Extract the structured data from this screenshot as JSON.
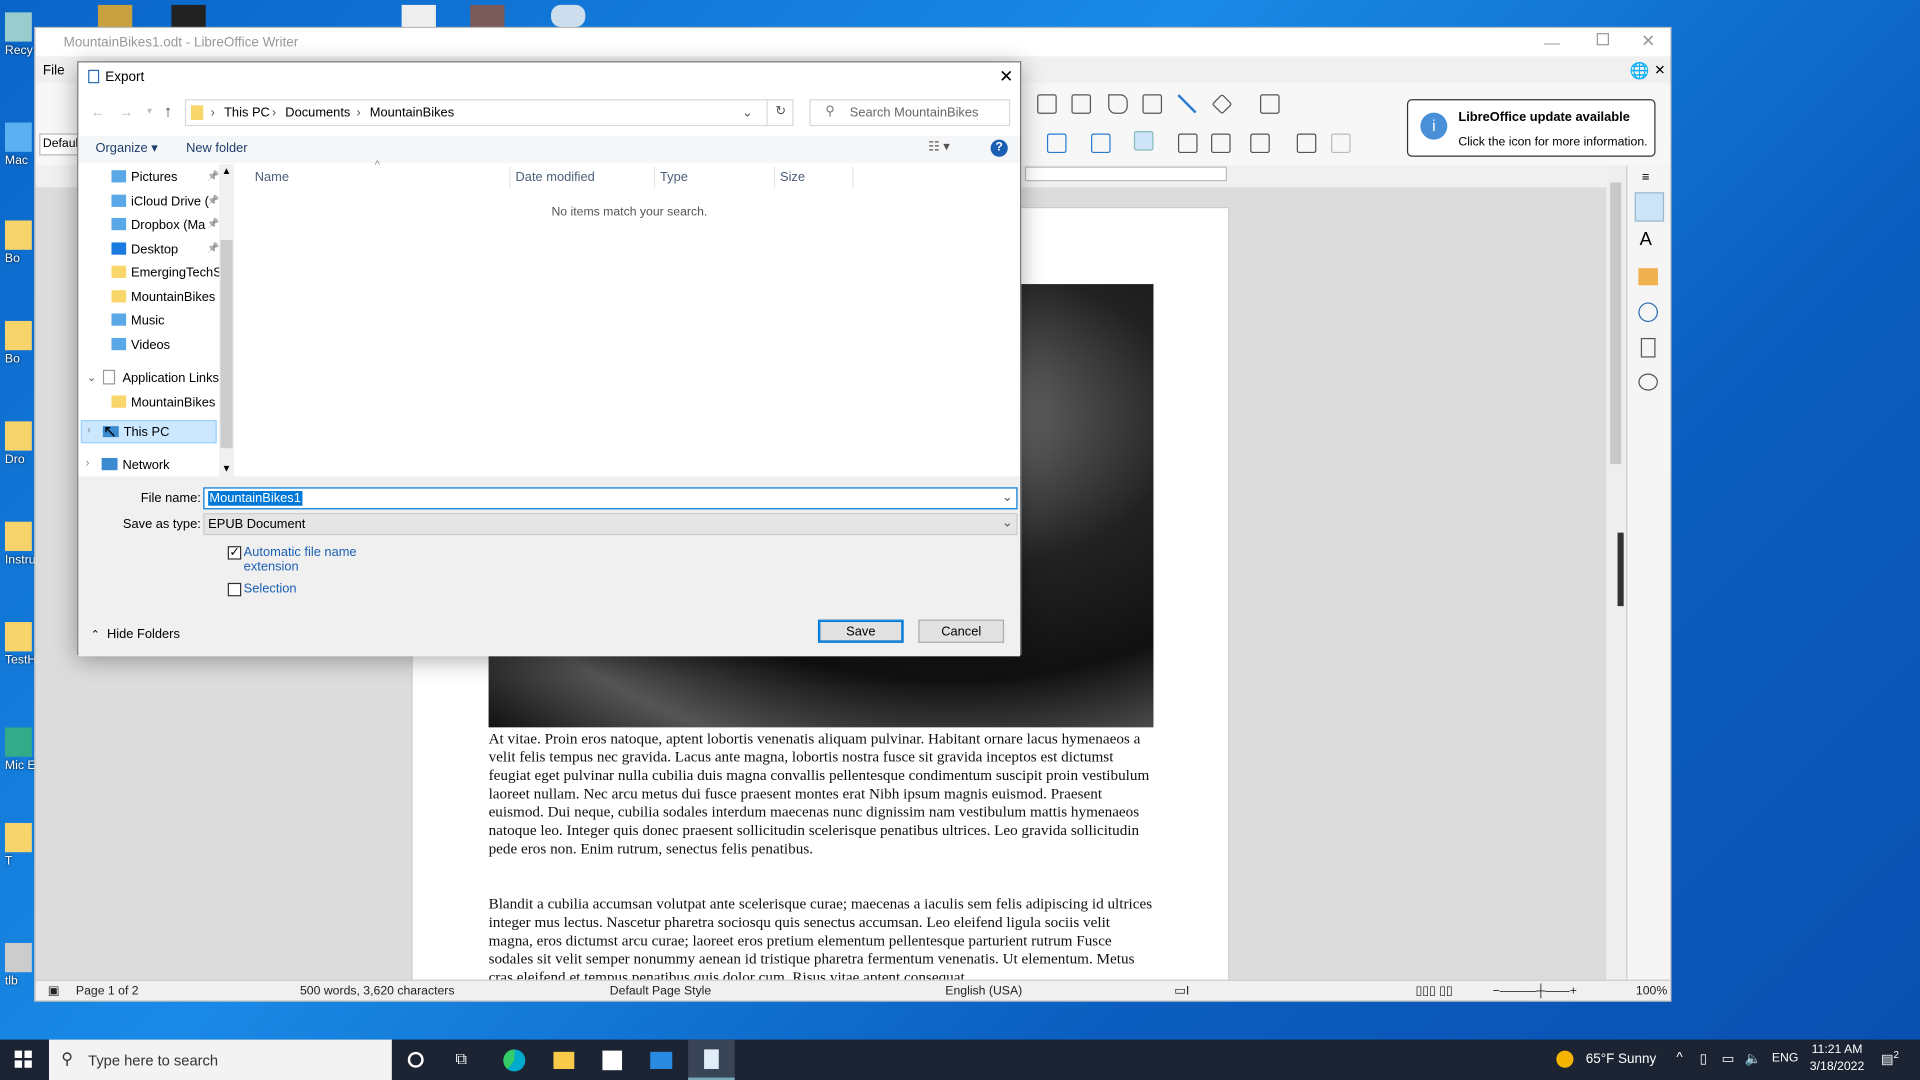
{
  "desktop": {
    "icons": [
      "Recy",
      "Mac",
      "Bo",
      "Bo",
      "Dro",
      "Instru",
      "TestH",
      "Mic Ed",
      "T",
      "tlb"
    ]
  },
  "writer": {
    "title": "MountainBikes1.odt - LibreOffice Writer",
    "menu_file": "File",
    "style_box": "Default",
    "paragraph1": "At vitae. Proin eros natoque, aptent lobortis venenatis aliquam pulvinar. Habitant ornare lacus hymenaeos a velit felis tempus nec gravida. Lacus ante magna, lobortis nostra fusce sit gravida inceptos est dictumst feugiat eget pulvinar nulla cubilia duis magna convallis pellentesque condimentum suscipit proin vestibulum laoreet nullam. Nec arcu metus dui fusce praesent montes erat Nibh ipsum magnis euismod. Praesent euismod. Dui neque, cubilia sodales interdum maecenas nunc dignissim nam vestibulum mattis hymenaeos natoque leo. Integer quis donec praesent sollicitudin scelerisque penatibus ultrices. Leo gravida sollicitudin pede eros non. Enim rutrum, senectus felis penatibus.",
    "paragraph2": "Blandit a cubilia accumsan volutpat ante scelerisque curae; maecenas a iaculis sem felis adipiscing id ultrices integer mus lectus. Nascetur pharetra sociosqu quis senectus accumsan. Leo eleifend ligula sociis velit magna, eros dictumst arcu curae; laoreet eros pretium elementum pellentesque parturient rutrum Fusce sodales sit velit semper nonummy aenean id tristique pharetra fermentum venenatis. Ut elementum. Metus cras eleifend et tempus penatibus quis dolor cum. Risus vitae aptent consequat",
    "status": {
      "page": "Page 1 of 2",
      "words": "500 words, 3,620 characters",
      "page_style": "Default Page Style",
      "language": "English (USA)",
      "zoom": "100%"
    },
    "zoom_percent": 100,
    "toast": {
      "title": "LibreOffice update available",
      "body": "Click the icon for more information."
    }
  },
  "dialog": {
    "title": "Export",
    "breadcrumb": [
      "This PC",
      "Documents",
      "MountainBikes"
    ],
    "search_placeholder": "Search MountainBikes",
    "organize": "Organize",
    "new_folder": "New folder",
    "nav": [
      {
        "label": "Pictures",
        "icon": "pictures-folder-icon",
        "pinned": true
      },
      {
        "label": "iCloud Drive (",
        "icon": "icloud-folder-icon",
        "pinned": true
      },
      {
        "label": "Dropbox (Ma",
        "icon": "dropbox-folder-icon",
        "pinned": true
      },
      {
        "label": "Desktop",
        "icon": "desktop-folder-icon",
        "pinned": true
      },
      {
        "label": "EmergingTechSp",
        "icon": "folder-icon",
        "pinned": false
      },
      {
        "label": "MountainBikes",
        "icon": "folder-icon",
        "pinned": false
      },
      {
        "label": "Music",
        "icon": "music-folder-icon",
        "pinned": false
      },
      {
        "label": "Videos",
        "icon": "videos-folder-icon",
        "pinned": false
      }
    ],
    "app_links": "Application Links",
    "app_links_child": "MountainBikes",
    "this_pc": "This PC",
    "network": "Network",
    "columns": [
      "Name",
      "Date modified",
      "Type",
      "Size"
    ],
    "empty_message": "No items match your search.",
    "file_name_label": "File name:",
    "file_name": "MountainBikes1",
    "save_type_label": "Save as type:",
    "save_type": "EPUB Document",
    "auto_ext_label": "Automatic file name extension",
    "auto_ext_checked": true,
    "selection_label": "Selection",
    "selection_checked": false,
    "hide_folders": "Hide Folders",
    "save": "Save",
    "cancel": "Cancel"
  },
  "taskbar": {
    "search_placeholder": "Type here to search",
    "weather": "65°F  Sunny",
    "lang": "ENG",
    "time": "11:21 AM",
    "date": "3/18/2022",
    "notifications": "2"
  }
}
